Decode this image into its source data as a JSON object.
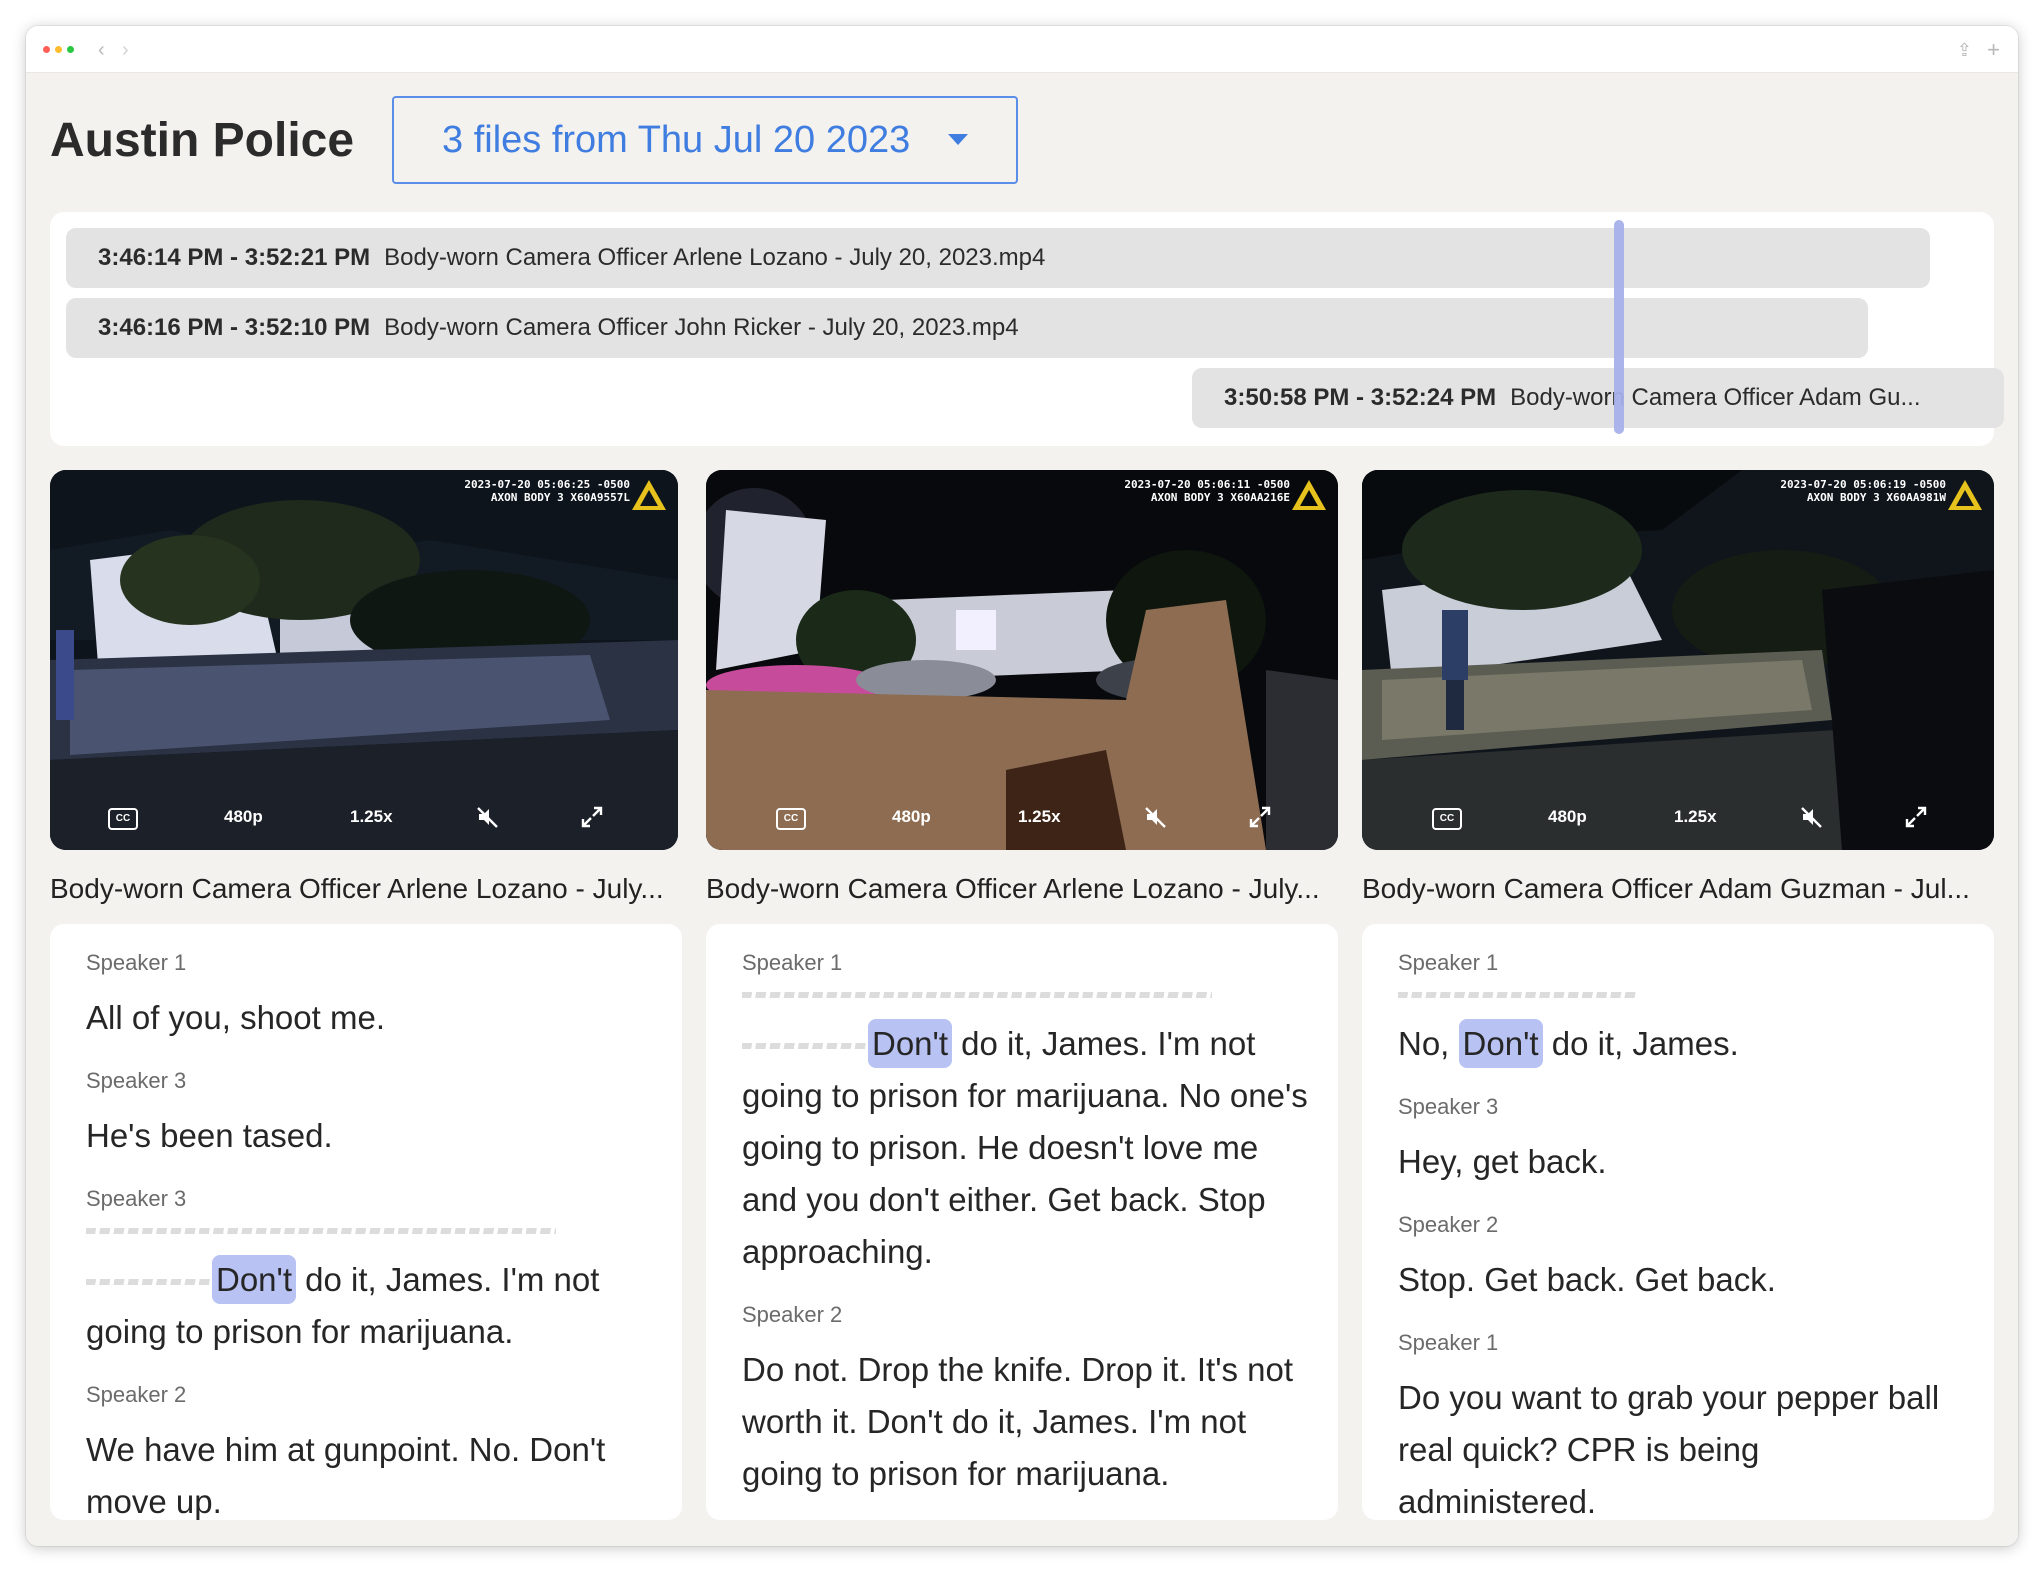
{
  "page": {
    "title": "Austin Police",
    "files_dropdown": "3 files from Thu Jul 20 2023"
  },
  "timeline": {
    "tracks": [
      {
        "time": "3:46:14 PM - 3:52:21 PM",
        "file": "Body-worn Camera Officer Arlene Lozano - July 20, 2023.mp4"
      },
      {
        "time": "3:46:16 PM - 3:52:10 PM",
        "file": "Body-worn Camera Officer John Ricker - July 20, 2023.mp4"
      },
      {
        "time": "3:50:58 PM - 3:52:24 PM",
        "file": "Body-worn Camera Officer Adam Gu..."
      }
    ]
  },
  "videos": [
    {
      "stamp_line1": "2023-07-20 05:06:25 -0500",
      "stamp_line2": "AXON BODY 3 X60A9557L",
      "cc": "CC",
      "quality": "480p",
      "speed": "1.25x",
      "caption": "Body-worn Camera Officer Arlene Lozano - July..."
    },
    {
      "stamp_line1": "2023-07-20 05:06:11 -0500",
      "stamp_line2": "AXON BODY 3 X60AA216E",
      "cc": "CC",
      "quality": "480p",
      "speed": "1.25x",
      "caption": "Body-worn Camera Officer Arlene Lozano - July..."
    },
    {
      "stamp_line1": "2023-07-20 05:06:19 -0500",
      "stamp_line2": "AXON BODY 3 X60AA981W",
      "cc": "CC",
      "quality": "480p",
      "speed": "1.25x",
      "caption": "Body-worn Camera Officer Adam Guzman - Jul..."
    }
  ],
  "transcripts": [
    {
      "b1": {
        "speaker": "Speaker 1",
        "text": "All of you, shoot me."
      },
      "b2": {
        "speaker": "Speaker 3",
        "text": "He's been tased."
      },
      "b3": {
        "speaker": "Speaker 3",
        "highlight": "Don't",
        "text": " do it, James. I'm not going to prison for marijuana."
      },
      "b4": {
        "speaker": "Speaker 2",
        "text": "We have him at gunpoint. No. Don't move up."
      }
    },
    {
      "b1": {
        "speaker": "Speaker 1",
        "highlight": "Don't",
        "text": " do it, James. I'm not going to prison for marijuana. No one's going to prison. He doesn't love me and you don't either. Get back. Stop approaching."
      },
      "b2": {
        "speaker": "Speaker 2",
        "text": "Do not. Drop the knife. Drop it. It's not worth it. Don't do it, James. I'm not going to prison for marijuana."
      }
    },
    {
      "b1": {
        "speaker": "Speaker 1",
        "prefix": "No, ",
        "highlight": "Don't",
        "text": " do it, James."
      },
      "b2": {
        "speaker": "Speaker 3",
        "text": "Hey, get back."
      },
      "b3": {
        "speaker": "Speaker 2",
        "text": "Stop. Get back. Get back."
      },
      "b4": {
        "speaker": "Speaker 1",
        "text": "Do you want to grab your pepper ball real quick? CPR is being administered."
      }
    }
  ],
  "colors": {
    "accent": "#3f7de0",
    "highlight": "#b8c2f3",
    "playhead": "#a7b0ea",
    "track": "#e3e3e3",
    "background": "#f4f2ee"
  },
  "icons": [
    "back-arrow-icon",
    "forward-arrow-icon",
    "share-icon",
    "plus-icon",
    "caret-down-icon",
    "axon-logo-icon",
    "closed-captions-icon",
    "muted-volume-icon",
    "fullscreen-icon"
  ]
}
